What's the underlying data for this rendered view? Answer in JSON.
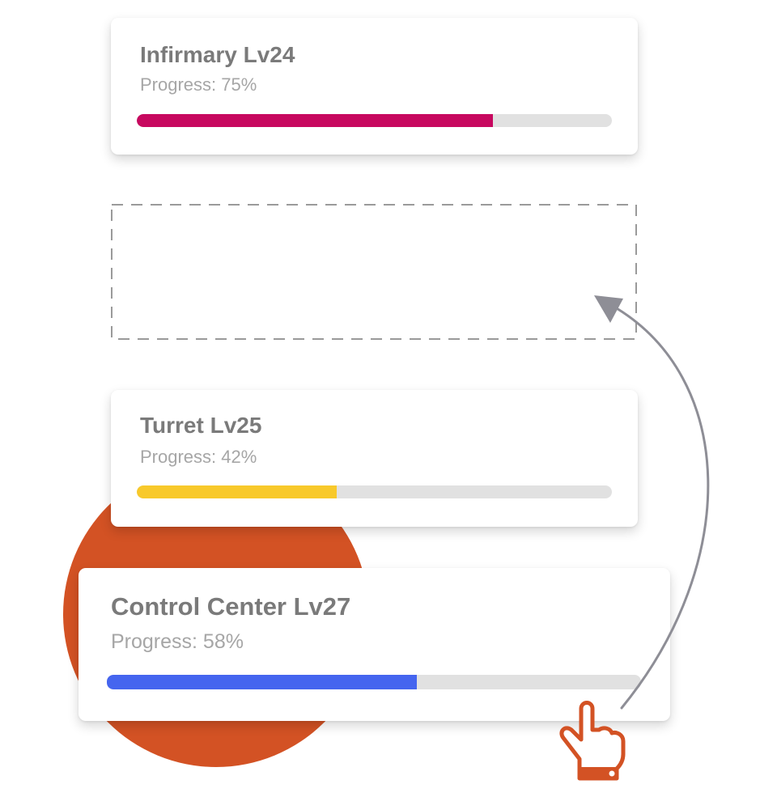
{
  "colors": {
    "background": "#ffffff",
    "accent_circle": "#d35224",
    "track": "#e1e1e1",
    "title_text": "#7a7a7a",
    "progress_text": "#a6a6a6",
    "drop_zone_border": "#9a9a9a",
    "arrow": "#8e8e96"
  },
  "cards": [
    {
      "title": "Infirmary Lv24",
      "progress_label": "Progress: 75%",
      "progress": 0.75,
      "bar_color": "#c7085f"
    },
    {
      "title": "Turret Lv25",
      "progress_label": "Progress: 42%",
      "progress": 0.42,
      "bar_color": "#f8c92b"
    },
    {
      "title": "Control Center Lv27",
      "progress_label": "Progress: 58%",
      "progress": 0.58,
      "bar_color": "#4565ef"
    }
  ],
  "icons": {
    "drag_pointer": "hand-pointer-icon",
    "drag_arrow": "curved-arrow-icon"
  }
}
